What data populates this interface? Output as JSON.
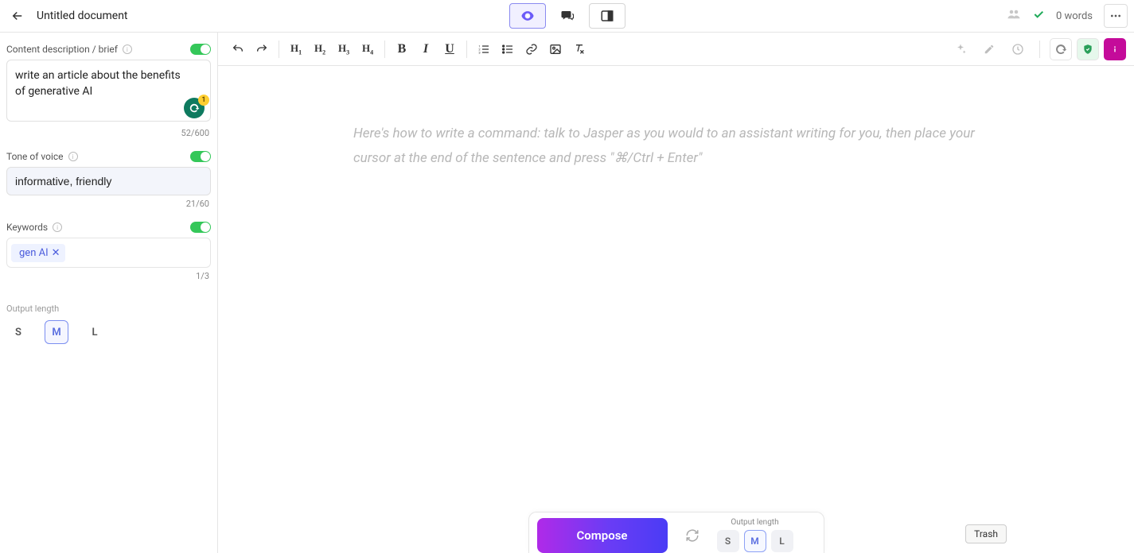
{
  "header": {
    "title": "Untitled document",
    "word_count": "0 words"
  },
  "view_modes": {
    "focus_active": true
  },
  "sidebar": {
    "desc_label": "Content description / brief",
    "desc_value": "write an article about the benefits of generative AI",
    "desc_counter": "52/600",
    "grammarly_count": "1",
    "tone_label": "Tone of voice",
    "tone_value": "informative, friendly",
    "tone_counter": "21/60",
    "keywords_label": "Keywords",
    "keywords": [
      "gen AI"
    ],
    "kw_counter": "1/3",
    "output_length_label": "Output length",
    "sizes": {
      "s": "S",
      "m": "M",
      "l": "L"
    },
    "size_selected": "M"
  },
  "editor": {
    "placeholder": "Here's how to write a command: talk to Jasper as you would to an assistant writing for you, then place your cursor at the end of the sentence and press \"⌘/Ctrl + Enter\""
  },
  "compose": {
    "button": "Compose",
    "output_length_label": "Output length",
    "sizes": {
      "s": "S",
      "m": "M",
      "l": "L"
    },
    "size_selected": "M"
  },
  "tooltip": {
    "trash": "Trash"
  }
}
